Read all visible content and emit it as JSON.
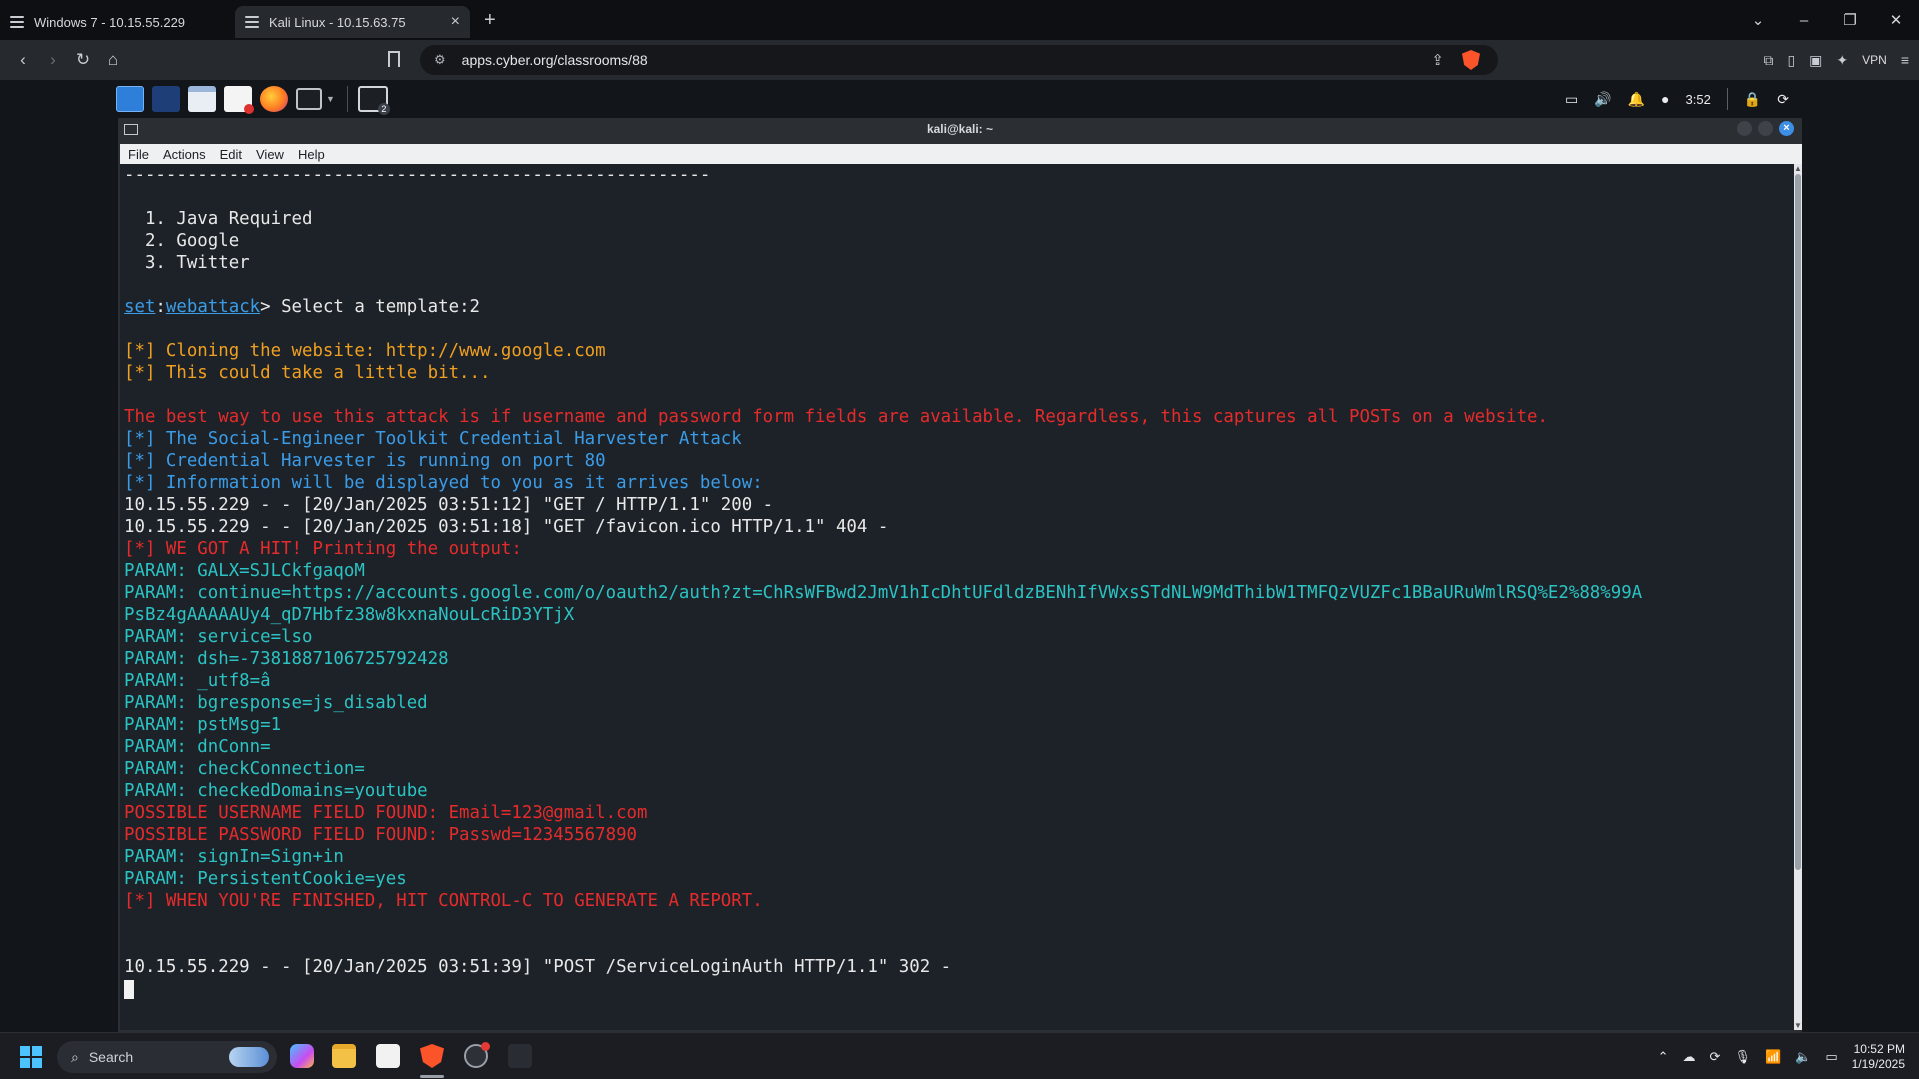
{
  "browser": {
    "tabs": [
      {
        "label": "Windows 7 - 10.15.55.229",
        "active": false
      },
      {
        "label": "Kali Linux - 10.15.63.75",
        "active": true
      }
    ],
    "new_tab": "+",
    "url": "apps.cyber.org/classrooms/88",
    "vpn_label": "VPN"
  },
  "remote_panel": {
    "clock": "3:52"
  },
  "terminal": {
    "title": "kali@kali: ~",
    "menu": [
      "File",
      "Actions",
      "Edit",
      "View",
      "Help"
    ],
    "lines": [
      {
        "color": "white",
        "text": "--------------------------------------------------------"
      },
      {
        "color": "white",
        "text": ""
      },
      {
        "color": "white",
        "text": "  1. Java Required"
      },
      {
        "color": "white",
        "text": "  2. Google"
      },
      {
        "color": "white",
        "text": "  3. Twitter"
      },
      {
        "color": "white",
        "text": ""
      },
      {
        "color": "prompt",
        "text": "> Select a template:2"
      },
      {
        "color": "white",
        "text": ""
      },
      {
        "color": "orange",
        "text": "[*] Cloning the website: http://www.google.com"
      },
      {
        "color": "orange",
        "text": "[*] This could take a little bit..."
      },
      {
        "color": "white",
        "text": ""
      },
      {
        "color": "red",
        "text": "The best way to use this attack is if username and password form fields are available. Regardless, this captures all POSTs on a website."
      },
      {
        "color": "blue",
        "text": "[*] The Social-Engineer Toolkit Credential Harvester Attack"
      },
      {
        "color": "blue",
        "text": "[*] Credential Harvester is running on port 80"
      },
      {
        "color": "blue",
        "text": "[*] Information will be displayed to you as it arrives below:"
      },
      {
        "color": "white",
        "text": "10.15.55.229 - - [20/Jan/2025 03:51:12] \"GET / HTTP/1.1\" 200 -"
      },
      {
        "color": "white",
        "text": "10.15.55.229 - - [20/Jan/2025 03:51:18] \"GET /favicon.ico HTTP/1.1\" 404 -"
      },
      {
        "color": "red",
        "text": "[*] WE GOT A HIT! Printing the output:"
      },
      {
        "color": "teal",
        "text": "PARAM: GALX=SJLCkfgaqoM"
      },
      {
        "color": "teal",
        "text": "PARAM: continue=https://accounts.google.com/o/oauth2/auth?zt=ChRsWFBwd2JmV1hIcDhtUFdldzBENhIfVWxsSTdNLW9MdThibW1TMFQzVUZFc1BBaURuWmlRSQ%E2%88%99A"
      },
      {
        "color": "teal",
        "text": "PsBz4gAAAAAUy4_qD7Hbfz38w8kxnaNouLcRiD3YTjX"
      },
      {
        "color": "teal",
        "text": "PARAM: service=lso"
      },
      {
        "color": "teal",
        "text": "PARAM: dsh=-7381887106725792428"
      },
      {
        "color": "teal",
        "text": "PARAM: _utf8=â"
      },
      {
        "color": "teal",
        "text": "PARAM: bgresponse=js_disabled"
      },
      {
        "color": "teal",
        "text": "PARAM: pstMsg=1"
      },
      {
        "color": "teal",
        "text": "PARAM: dnConn="
      },
      {
        "color": "teal",
        "text": "PARAM: checkConnection="
      },
      {
        "color": "teal",
        "text": "PARAM: checkedDomains=youtube"
      },
      {
        "color": "red",
        "text": "POSSIBLE USERNAME FIELD FOUND: Email=123@gmail.com"
      },
      {
        "color": "red",
        "text": "POSSIBLE PASSWORD FIELD FOUND: Passwd=12345567890"
      },
      {
        "color": "teal",
        "text": "PARAM: signIn=Sign+in"
      },
      {
        "color": "teal",
        "text": "PARAM: PersistentCookie=yes"
      },
      {
        "color": "red",
        "text": "[*] WHEN YOU'RE FINISHED, HIT CONTROL-C TO GENERATE A REPORT."
      },
      {
        "color": "white",
        "text": ""
      },
      {
        "color": "white",
        "text": ""
      },
      {
        "color": "white",
        "text": "10.15.55.229 - - [20/Jan/2025 03:51:39] \"POST /ServiceLoginAuth HTTP/1.1\" 302 -"
      }
    ],
    "prompt_set": "set",
    "prompt_module": "webattack"
  },
  "taskbar": {
    "search_placeholder": "Search",
    "time": "10:52 PM",
    "date": "1/19/2025"
  },
  "colors": {
    "white": "#e8e8e8",
    "orange": "#f0a020",
    "red": "#e52b2b",
    "blue": "#3b9ce8",
    "teal": "#2bc3c3"
  }
}
